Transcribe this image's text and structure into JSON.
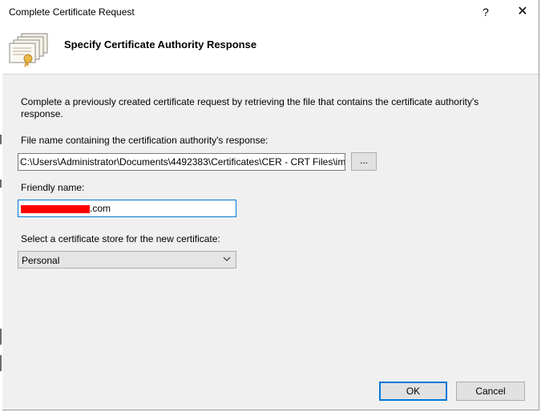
{
  "window": {
    "title": "Complete Certificate Request",
    "help_glyph": "?",
    "close_glyph": "✕"
  },
  "header": {
    "title": "Specify Certificate Authority Response",
    "icon": "certificate-stack-icon"
  },
  "description": "Complete a previously created certificate request by retrieving the file that contains the certificate authority's response.",
  "file_field": {
    "label": "File name containing the certification authority's response:",
    "value": "C:\\Users\\Administrator\\Documents\\4492383\\Certificates\\CER - CRT Files\\im",
    "browse_label": "..."
  },
  "friendly_field": {
    "label": "Friendly name:",
    "visible_value": ".com"
  },
  "store_field": {
    "label": "Select a certificate store for the new certificate:",
    "selected": "Personal"
  },
  "buttons": {
    "ok": "OK",
    "cancel": "Cancel"
  },
  "colors": {
    "accent": "#0078d7",
    "redaction": "#ff0000",
    "dialog_bg": "#f0f0f0"
  }
}
